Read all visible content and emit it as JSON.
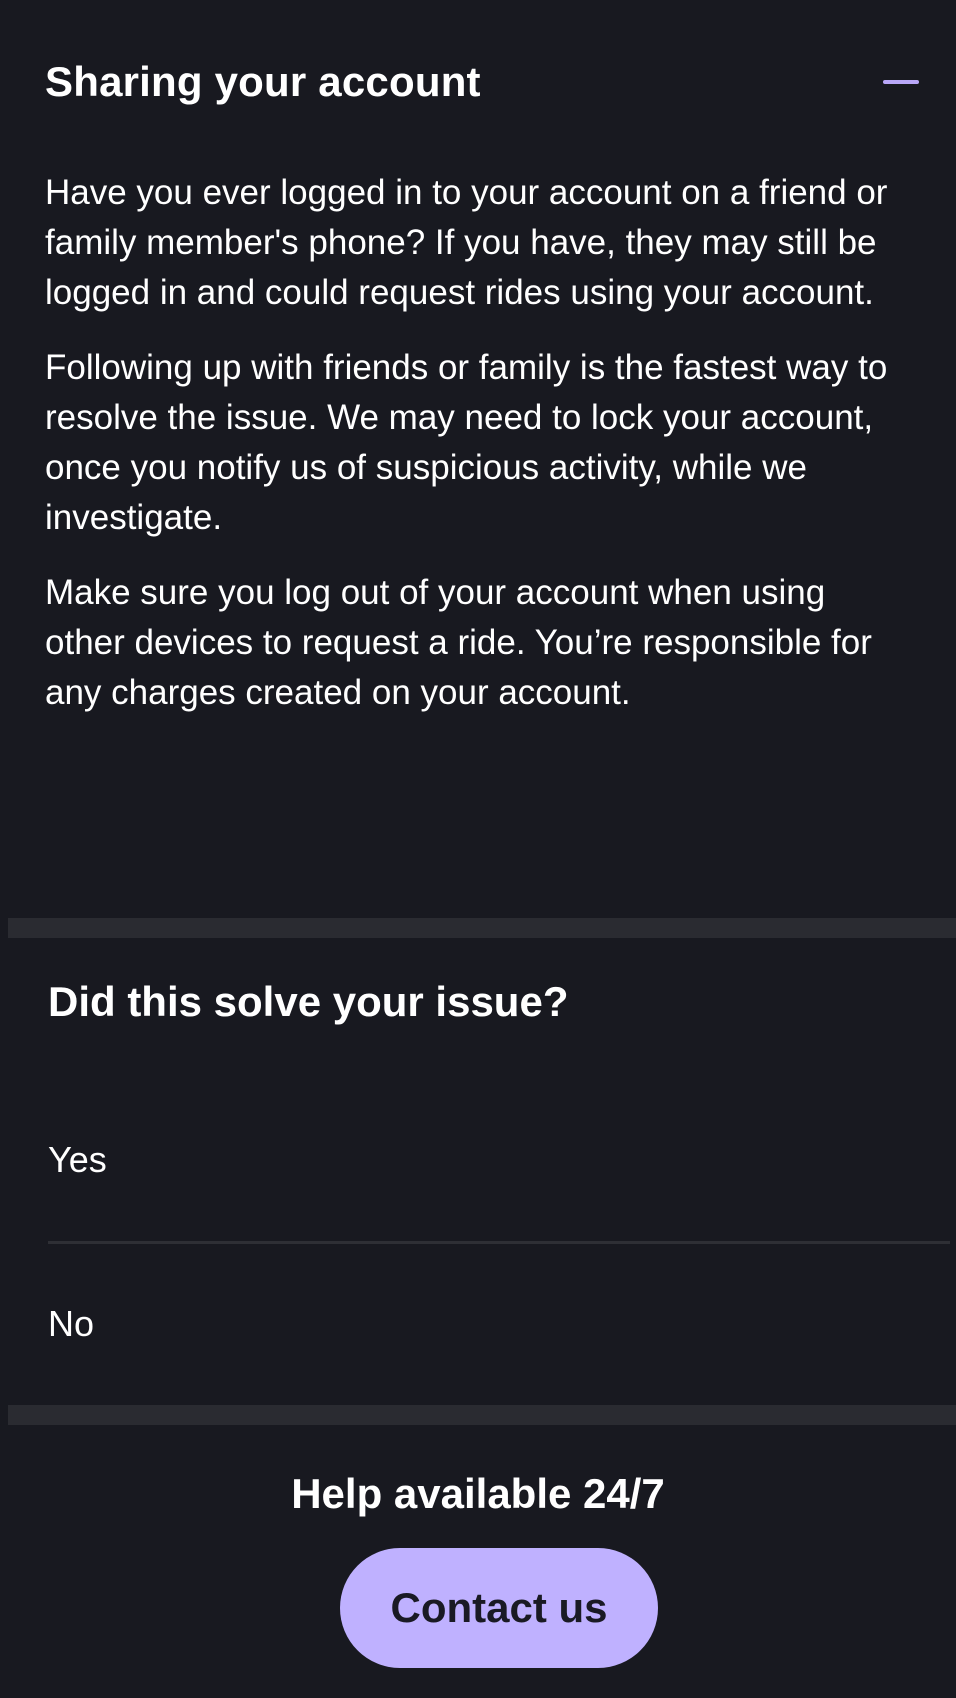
{
  "accordion": {
    "title": "Sharing your account",
    "collapse_icon": "minus-icon",
    "paragraphs": [
      "Have you ever logged in to your account on a friend or family member's phone? If you have, they may still be logged in and could request rides using your account.",
      "Following up with friends or family is the fastest way to resolve the issue. We may need to lock your account, once you notify us of suspicious activity, while we investigate.",
      "Make sure you log out of your account when using other devices to request a ride. You’re responsible for any charges created on your account."
    ]
  },
  "feedback": {
    "question": "Did this solve your issue?",
    "options": [
      "Yes",
      "No"
    ]
  },
  "help": {
    "title": "Help available 24/7",
    "contact_label": "Contact us"
  },
  "colors": {
    "background": "#181920",
    "accent": "#b9a7f8",
    "button": "#bfb1ff",
    "divider": "#2a2b31"
  }
}
